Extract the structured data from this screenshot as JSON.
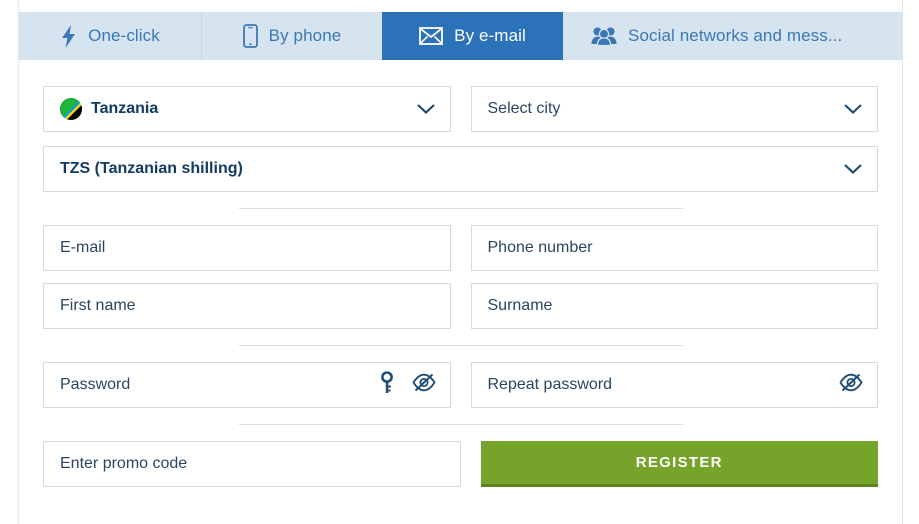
{
  "tabs": [
    {
      "label": "One-click",
      "icon": "lightning-bolt-icon",
      "active": false
    },
    {
      "label": "By phone",
      "icon": "mobile-phone-icon",
      "active": false
    },
    {
      "label": "By e-mail",
      "icon": "envelope-icon",
      "active": true
    },
    {
      "label": "Social networks and mess...",
      "icon": "people-group-icon",
      "active": false
    }
  ],
  "form": {
    "country": {
      "value": "Tanzania",
      "icon": "tanzania-flag-icon",
      "caret": "chevron-down-icon"
    },
    "city": {
      "placeholder": "Select city",
      "value": "",
      "caret": "chevron-down-icon"
    },
    "currency": {
      "value": "TZS (Tanzanian shilling)",
      "caret": "chevron-down-icon"
    },
    "email": {
      "placeholder": "E-mail",
      "value": ""
    },
    "phone": {
      "placeholder": "Phone number",
      "value": ""
    },
    "first_name": {
      "placeholder": "First name",
      "value": ""
    },
    "surname": {
      "placeholder": "Surname",
      "value": ""
    },
    "password": {
      "placeholder": "Password",
      "value": "",
      "key_icon": "key-icon",
      "toggle_icon": "eye-slash-icon"
    },
    "repeat_password": {
      "placeholder": "Repeat password",
      "value": "",
      "toggle_icon": "eye-slash-icon"
    },
    "promo": {
      "placeholder": "Enter promo code",
      "value": ""
    },
    "register_label": "REGISTER"
  },
  "colors": {
    "tabbar_bg": "#d6e4f0",
    "tab_text": "#3a78b5",
    "tab_active_bg": "#2b72b8",
    "tab_active_text": "#ffffff",
    "field_border": "#d9d9d9",
    "placeholder_text": "#2b4562",
    "value_text": "#123b63",
    "register_green": "#76a32a",
    "register_green_shadow": "#5e8420",
    "divider": "#dcdcdc"
  }
}
